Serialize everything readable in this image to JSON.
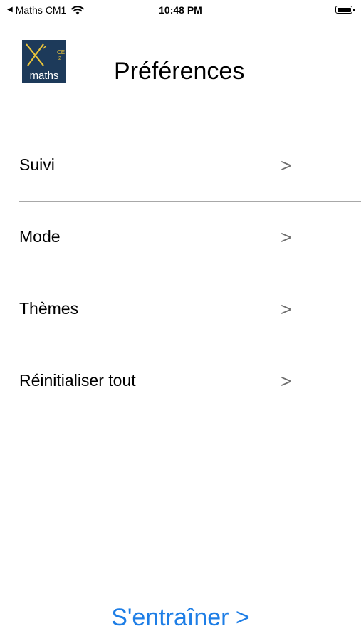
{
  "status_bar": {
    "back_app": "Maths CM1",
    "back_glyph": "◀",
    "time": "10:48 PM"
  },
  "header": {
    "logo_text": "maths",
    "logo_badge": "CE",
    "logo_badge_sub": "2",
    "title": "Préférences"
  },
  "menu": {
    "items": [
      {
        "label": "Suivi",
        "chevron": ">"
      },
      {
        "label": "Mode",
        "chevron": ">"
      },
      {
        "label": "Thèmes",
        "chevron": ">"
      },
      {
        "label": "Réinitialiser tout",
        "chevron": ">"
      }
    ]
  },
  "footer": {
    "train_label": "S'entraîner >"
  },
  "colors": {
    "accent": "#1e7ee6",
    "logo_bg": "#1d3a5a",
    "logo_mark": "#e8c33a",
    "divider": "#a8a8a8",
    "chevron": "#6e6e6e"
  },
  "icons": [
    "back-arrow-icon",
    "wifi-icon",
    "battery-icon",
    "app-logo-icon",
    "chevron-right-icon"
  ]
}
